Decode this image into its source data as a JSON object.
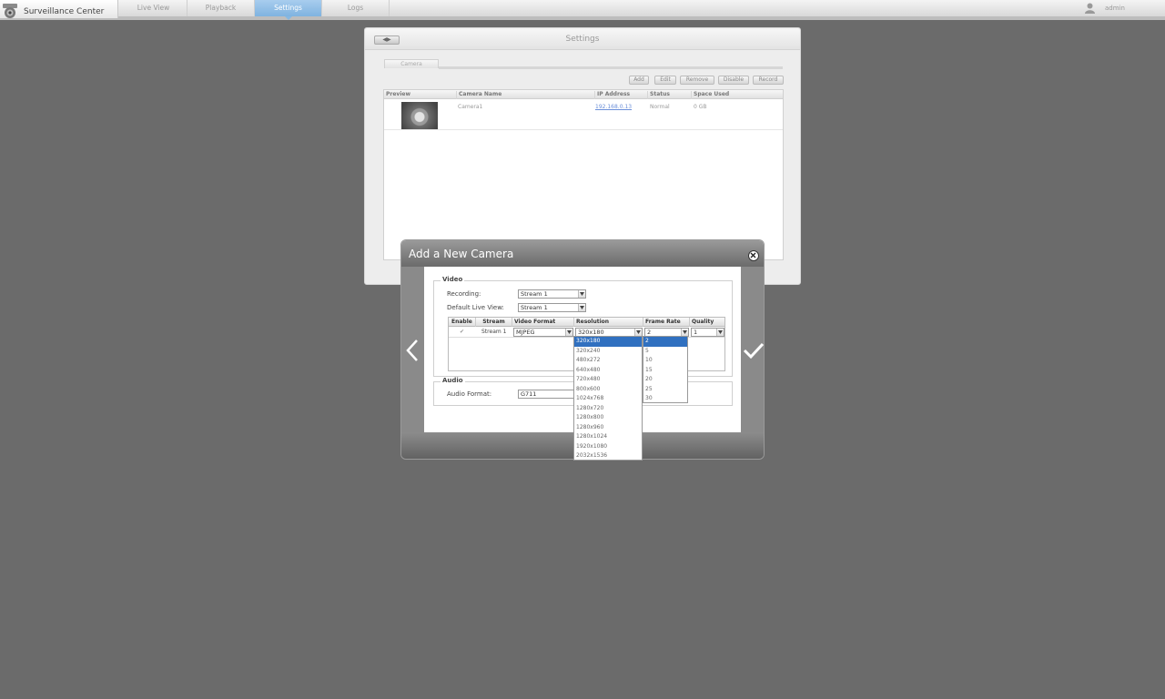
{
  "app": {
    "title": "Surveillance Center",
    "user": "admin"
  },
  "nav": {
    "tabs": [
      {
        "label": "Live View"
      },
      {
        "label": "Playback"
      },
      {
        "label": "Settings"
      },
      {
        "label": "Logs"
      }
    ]
  },
  "settings": {
    "back_label": "◀▶",
    "title": "Settings",
    "tab": "Camera",
    "toolbar": {
      "add": "Add",
      "edit": "Edit",
      "remove": "Remove",
      "disable": "Disable",
      "record": "Record"
    },
    "columns": [
      "Preview",
      "Camera Name",
      "IP Address",
      "Status",
      "Space Used"
    ],
    "rows": [
      {
        "name": "Camera1",
        "ip": "192.168.0.13",
        "status": "Normal",
        "space": "0 GB"
      }
    ]
  },
  "modal": {
    "title": "Add a New Camera",
    "video": {
      "legend": "Video",
      "recording_label": "Recording:",
      "recording_value": "Stream 1",
      "live_view_label": "Default Live View:",
      "live_view_value": "Stream 1",
      "columns": [
        "Enable",
        "Stream",
        "Video Format",
        "Resolution",
        "Frame Rate",
        "Quality"
      ],
      "row": {
        "enable": "✔",
        "stream": "Stream 1",
        "format": "MJPEG",
        "resolution": "320x180",
        "frame_rate": "2",
        "quality": "1"
      }
    },
    "audio": {
      "legend": "Audio",
      "format_label": "Audio Format:",
      "format_value": "G711"
    },
    "resolution_options": [
      "320x180",
      "320x240",
      "480x272",
      "640x480",
      "720x480",
      "800x600",
      "1024x768",
      "1280x720",
      "1280x800",
      "1280x960",
      "1280x1024",
      "1920x1080",
      "2032x1536"
    ],
    "resolution_selected_index": 0,
    "frame_rate_options": [
      "2",
      "5",
      "10",
      "15",
      "20",
      "25",
      "30"
    ],
    "frame_rate_selected_index": 0
  }
}
